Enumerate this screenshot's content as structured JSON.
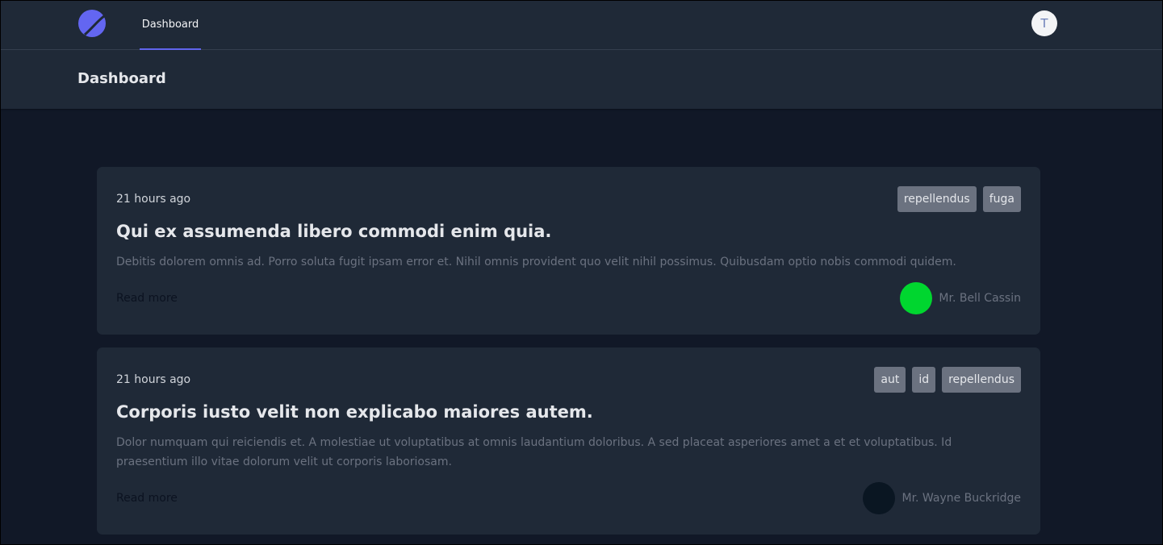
{
  "nav": {
    "tab_label": "Dashboard",
    "user_initial": "T",
    "accent_color": "#6366f1"
  },
  "header": {
    "title": "Dashboard"
  },
  "posts": [
    {
      "time": "21 hours ago",
      "tags": [
        "repellendus",
        "fuga"
      ],
      "title": "Qui ex assumenda libero commodi enim quia.",
      "body": "Debitis dolorem omnis ad. Porro soluta fugit ipsam error et. Nihil omnis provident quo velit nihil possimus. Quibusdam optio nobis commodi quidem.",
      "read_more": "Read more",
      "author": "Mr. Bell Cassin",
      "avatar_color": "#00d62f"
    },
    {
      "time": "21 hours ago",
      "tags": [
        "aut",
        "id",
        "repellendus"
      ],
      "title": "Corporis iusto velit non explicabo maiores autem.",
      "body": "Dolor numquam qui reiciendis et. A molestiae ut voluptatibus at omnis laudantium doloribus. A sed placeat asperiores amet a et et voluptatibus. Id praesentium illo vitae dolorum velit ut corporis laboriosam.",
      "read_more": "Read more",
      "author": "Mr. Wayne Buckridge",
      "avatar_color": "#0a1622"
    }
  ]
}
